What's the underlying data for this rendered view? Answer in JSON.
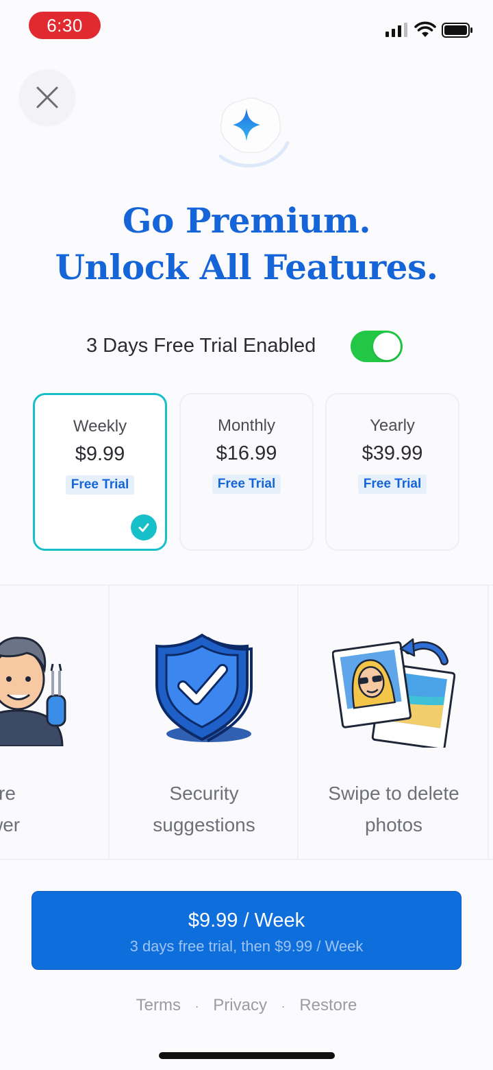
{
  "status_bar": {
    "time": "6:30"
  },
  "header": {
    "headline_line1": "Go Premium.",
    "headline_line2": "Unlock All Features."
  },
  "trial": {
    "label": "3 Days Free Trial Enabled",
    "enabled": true,
    "toggle_color": "#22c845"
  },
  "plans": [
    {
      "name": "Weekly",
      "price": "$9.99",
      "tag": "Free Trial",
      "selected": true
    },
    {
      "name": "Monthly",
      "price": "$16.99",
      "tag": "Free Trial",
      "selected": false
    },
    {
      "name": "Yearly",
      "price": "$39.99",
      "tag": "Free Trial",
      "selected": false
    }
  ],
  "features": [
    {
      "line1": "More",
      "line2": "power",
      "icon": "technician-icon"
    },
    {
      "line1": "Security",
      "line2": "suggestions",
      "icon": "shield-check-icon"
    },
    {
      "line1": "Swipe to delete",
      "line2": "photos",
      "icon": "photos-swipe-icon"
    }
  ],
  "cta": {
    "main": "$9.99 / Week",
    "sub": "3 days free trial, then $9.99 / Week"
  },
  "links": {
    "terms": "Terms",
    "privacy": "Privacy",
    "restore": "Restore",
    "separator": "·"
  },
  "colors": {
    "accent": "#1565d8",
    "selected_border": "#17c0c8",
    "cta": "#0e6fdc",
    "time_pill": "#e02a2f"
  }
}
